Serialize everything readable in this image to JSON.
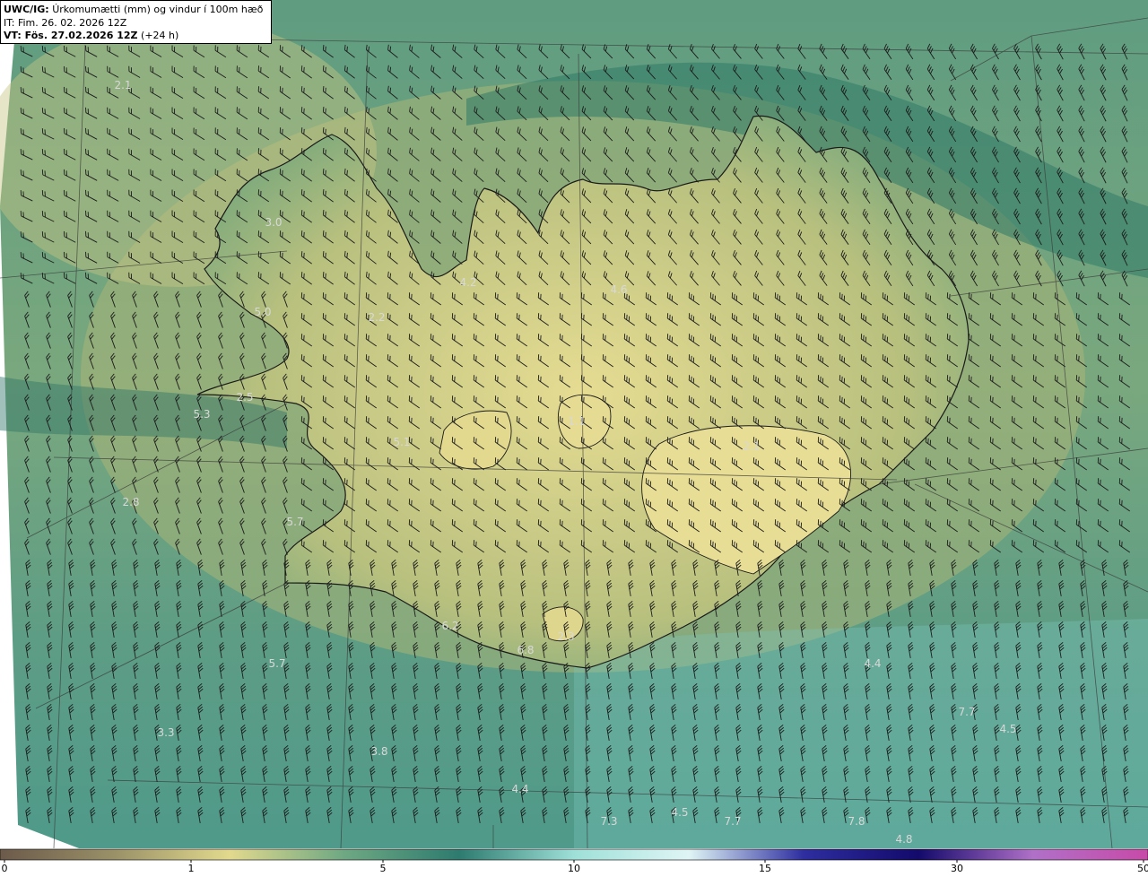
{
  "header": {
    "model": "UWC/IG:",
    "title": "Úrkomumætti (mm) og vindur í 100m hæð",
    "init_time": "IT: Fim. 26. 02. 2026 12Z",
    "valid_prefix": "VT: Fös. 27.02.2026 12Z",
    "valid_suffix": "(+24 h)"
  },
  "colorbar": {
    "ticks": [
      "0",
      "1",
      "5",
      "10",
      "15",
      "30",
      "50"
    ],
    "colors": [
      "#6b5a4a",
      "#9a9168",
      "#e2d98e",
      "#6ea883",
      "#2e7b6f",
      "#9ee0d8",
      "#dff5f5",
      "#2e2ea0",
      "#130a6b",
      "#b070c8",
      "#c84aa8"
    ]
  },
  "map_labels": [
    {
      "text": "2.1"
    },
    {
      "text": "3.0"
    },
    {
      "text": "5.0"
    },
    {
      "text": "4.2"
    },
    {
      "text": "2.2"
    },
    {
      "text": "4.6"
    },
    {
      "text": "2.5"
    },
    {
      "text": "5.3"
    },
    {
      "text": "5.1"
    },
    {
      "text": "1.1"
    },
    {
      "text": "2.1"
    },
    {
      "text": "2.8"
    },
    {
      "text": "5.7"
    },
    {
      "text": "6.2"
    },
    {
      "text": "5.7"
    },
    {
      "text": "6.8"
    },
    {
      "text": "2.3"
    },
    {
      "text": "4.4"
    },
    {
      "text": "7.7"
    },
    {
      "text": "4.5"
    },
    {
      "text": "3.3"
    },
    {
      "text": "3.8"
    },
    {
      "text": "4.4"
    },
    {
      "text": "7.3"
    },
    {
      "text": "4.5"
    },
    {
      "text": "7.7"
    },
    {
      "text": "7.8"
    },
    {
      "text": "4.8"
    }
  ]
}
